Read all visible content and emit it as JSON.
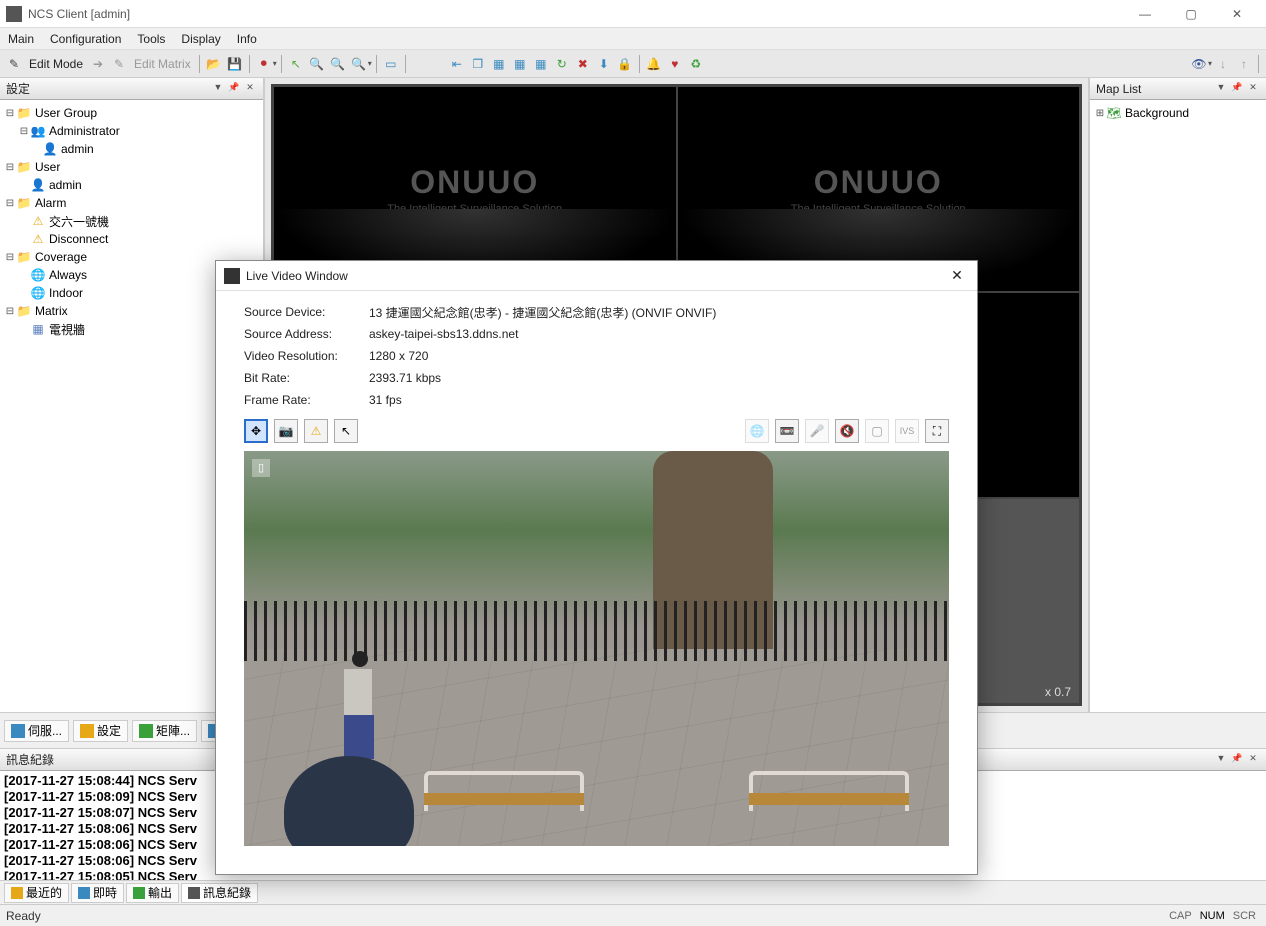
{
  "window": {
    "title": "NCS Client [admin]"
  },
  "menu": [
    "Main",
    "Configuration",
    "Tools",
    "Display",
    "Info"
  ],
  "toolbar": {
    "edit_mode": "Edit Mode",
    "edit_matrix": "Edit Matrix"
  },
  "left_panel": {
    "title": "設定",
    "tree": {
      "user_group": "User Group",
      "administrator": "Administrator",
      "admin1": "admin",
      "user": "User",
      "admin2": "admin",
      "alarm": "Alarm",
      "alarm1": "交六一號機",
      "alarm2": "Disconnect",
      "coverage": "Coverage",
      "cov1": "Always",
      "cov2": "Indoor",
      "matrix": "Matrix",
      "matrix1": "電視牆"
    }
  },
  "right_panel": {
    "title": "Map List",
    "background": "Background"
  },
  "video_grid": {
    "logo": "ONUUO",
    "logo_sub": "The Intelligent Surveillance Solution",
    "zoom": "x 0.7"
  },
  "upper_tabs": [
    "伺服...",
    "設定",
    "矩陣...",
    ""
  ],
  "dialog": {
    "title": "Live Video Window",
    "rows": [
      {
        "label": "Source Device:",
        "value": "13 捷運國父紀念館(忠孝) - 捷運國父紀念館(忠孝) (ONVIF ONVIF)"
      },
      {
        "label": "Source Address:",
        "value": "askey-taipei-sbs13.ddns.net"
      },
      {
        "label": "Video Resolution:",
        "value": "1280 x 720"
      },
      {
        "label": "Bit Rate:",
        "value": "2393.71 kbps"
      },
      {
        "label": "Frame Rate:",
        "value": "31 fps"
      }
    ],
    "rec": "▯"
  },
  "log_panel": {
    "title": "訊息紀錄",
    "lines": [
      "[2017-11-27 15:08:44] NCS Serv",
      "[2017-11-27 15:08:09] NCS Serv",
      "[2017-11-27 15:08:07] NCS Serv",
      "[2017-11-27 15:08:06] NCS Serv",
      "[2017-11-27 15:08:06] NCS Serv",
      "[2017-11-27 15:08:06] NCS Serv",
      "[2017-11-27 15:08:05] NCS Serv"
    ],
    "tabs": [
      "最近的",
      "即時",
      "輸出",
      "訊息紀錄"
    ]
  },
  "status": {
    "ready": "Ready",
    "cap": "CAP",
    "num": "NUM",
    "scr": "SCR"
  }
}
